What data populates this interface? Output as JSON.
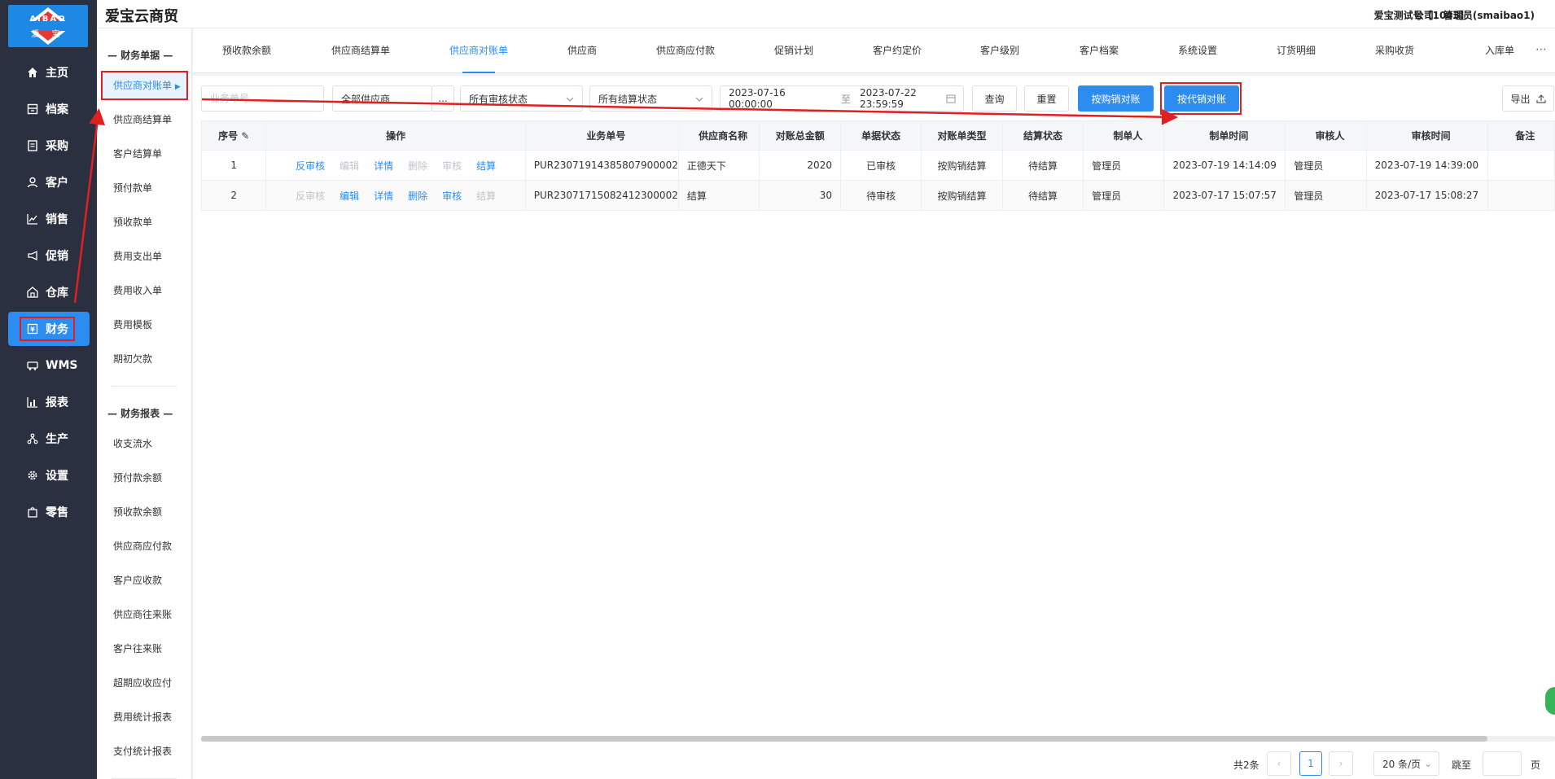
{
  "logo": {
    "top_text": "AIBAO",
    "bottom_text": "爱 宝"
  },
  "header": {
    "brand": "爱宝云商贸",
    "account": "爱宝测试号【1043】",
    "company": "公司：管理员(smaibao1)"
  },
  "nav": [
    {
      "label": "主页",
      "icon": "home-icon"
    },
    {
      "label": "档案",
      "icon": "archive-icon"
    },
    {
      "label": "采购",
      "icon": "purchase-icon"
    },
    {
      "label": "客户",
      "icon": "user-icon"
    },
    {
      "label": "销售",
      "icon": "chart-line-icon"
    },
    {
      "label": "促销",
      "icon": "megaphone-icon"
    },
    {
      "label": "仓库",
      "icon": "warehouse-icon"
    },
    {
      "label": "财务",
      "icon": "finance-icon"
    },
    {
      "label": "WMS",
      "icon": "truck-icon"
    },
    {
      "label": "报表",
      "icon": "bar-chart-icon"
    },
    {
      "label": "生产",
      "icon": "network-icon"
    },
    {
      "label": "设置",
      "icon": "gear-icon"
    },
    {
      "label": "零售",
      "icon": "bag-icon"
    }
  ],
  "subnav": {
    "section1": "— 财务单据 —",
    "items1": [
      "供应商对账单",
      "供应商结算单",
      "客户结算单",
      "预付款单",
      "预收款单",
      "费用支出单",
      "费用收入单",
      "费用模板",
      "期初欠款"
    ],
    "section2": "— 财务报表 —",
    "items2": [
      "收支流水",
      "预付款余额",
      "预收款余额",
      "供应商应付款",
      "客户应收款",
      "供应商往来账",
      "客户往来账",
      "超期应收应付",
      "费用统计报表",
      "支付统计报表"
    ]
  },
  "tabs": [
    "预收款余额",
    "供应商结算单",
    "供应商对账单",
    "供应商",
    "供应商应付款",
    "促销计划",
    "客户约定价",
    "客户级别",
    "客户档案",
    "系统设置",
    "订货明细",
    "采购收货",
    "入库单"
  ],
  "filters": {
    "doc_placeholder": "业务单号",
    "supplier": "全部供应商",
    "more": "...",
    "audit": "所有审核状态",
    "settle": "所有结算状态",
    "date_start": "2023-07-16 00:00:00",
    "date_sep": "至",
    "date_end": "2023-07-22 23:59:59",
    "query": "查询",
    "reset": "重置",
    "by_purchase": "按购销对账",
    "by_consign": "按代销对账",
    "export": "导出"
  },
  "table": {
    "columns": [
      "序号",
      "操作",
      "业务单号",
      "供应商名称",
      "对账总金额",
      "单据状态",
      "对账单类型",
      "结算状态",
      "制单人",
      "制单时间",
      "审核人",
      "审核时间",
      "备注"
    ],
    "rows": [
      {
        "index": "1",
        "ops": [
          {
            "label": "反审核",
            "enabled": true
          },
          {
            "label": "编辑",
            "enabled": false
          },
          {
            "label": "详情",
            "enabled": true
          },
          {
            "label": "删除",
            "enabled": false
          },
          {
            "label": "审核",
            "enabled": false
          },
          {
            "label": "结算",
            "enabled": true
          }
        ],
        "doc_no": "PUR23071914385807900002",
        "supplier": "正德天下",
        "amount": "2020",
        "status": "已审核",
        "type": "按购销结算",
        "settle": "待结算",
        "creator": "管理员",
        "created_at": "2023-07-19 14:14:09",
        "auditor": "管理员",
        "audited_at": "2023-07-19 14:39:00",
        "remark": ""
      },
      {
        "index": "2",
        "ops": [
          {
            "label": "反审核",
            "enabled": false
          },
          {
            "label": "编辑",
            "enabled": true
          },
          {
            "label": "详情",
            "enabled": true
          },
          {
            "label": "删除",
            "enabled": true
          },
          {
            "label": "审核",
            "enabled": true
          },
          {
            "label": "结算",
            "enabled": false
          }
        ],
        "doc_no": "PUR23071715082412300002",
        "supplier": "结算",
        "amount": "30",
        "status": "待审核",
        "type": "按购销结算",
        "settle": "待结算",
        "creator": "管理员",
        "created_at": "2023-07-17 15:07:57",
        "auditor": "管理员",
        "audited_at": "2023-07-17 15:08:27",
        "remark": ""
      }
    ]
  },
  "pager": {
    "total": "共2条",
    "current": "1",
    "size": "20 条/页",
    "goto": "跳至",
    "page_unit": "页"
  },
  "colors": {
    "primary": "#2d8cf0",
    "sidebar": "#2b3040",
    "highlight": "#e02020"
  }
}
